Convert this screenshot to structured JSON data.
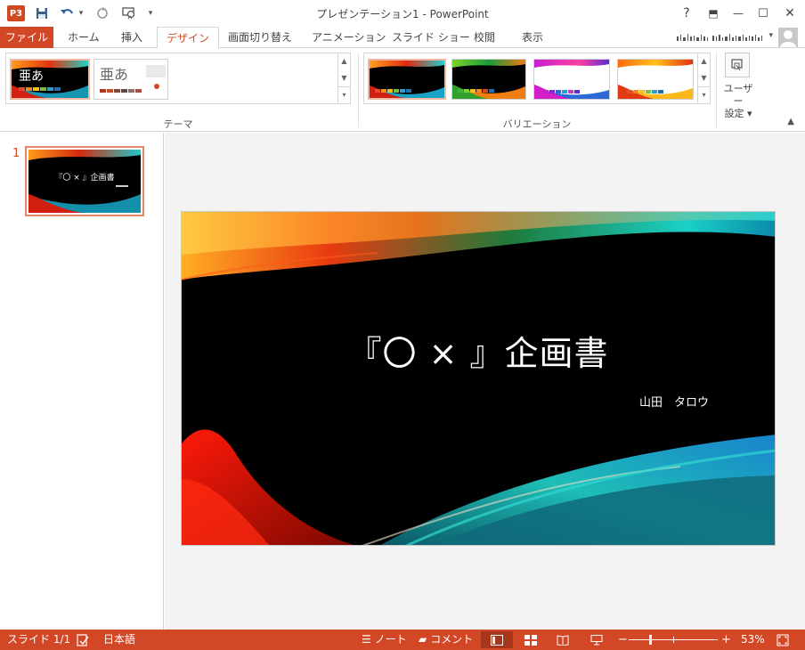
{
  "window": {
    "title": "プレゼンテーション1 - PowerPoint",
    "app_icon": "P3",
    "controls": {
      "help": "?",
      "ribbon_display": "⬒",
      "minimize": "—",
      "maximize": "☐",
      "close": "✕"
    }
  },
  "quick_access": {
    "save": "save-icon",
    "undo": "undo-icon",
    "redo": "redo-icon",
    "present": "present-from-start-icon",
    "customize": "▾"
  },
  "tabs": [
    {
      "label": "ファイル"
    },
    {
      "label": "ホーム"
    },
    {
      "label": "挿入"
    },
    {
      "label": "デザイン"
    },
    {
      "label": "画面切り替え"
    },
    {
      "label": "アニメーション"
    },
    {
      "label": "スライド ショー"
    },
    {
      "label": "校閲"
    },
    {
      "label": "表示"
    }
  ],
  "ribbon": {
    "themes_label": "テーマ",
    "theme_sample_text": "亜あ",
    "variations_label": "バリエーション",
    "customize": {
      "line1": "ユーザー",
      "line2": "設定 ▾"
    }
  },
  "slide_pane": {
    "slide_number": "1",
    "thumb_title": "『〇 × 』企画書"
  },
  "slide": {
    "title": "『〇 × 』企画書",
    "subtitle": "山田　タロウ"
  },
  "status": {
    "slide_indicator": "スライド 1/1",
    "language": "日本語",
    "notes": "ノート",
    "comments": "コメント",
    "zoom": "53%",
    "minus": "−",
    "plus": "+"
  },
  "colors": {
    "accent": "#d24726",
    "status_bg": "#d24726",
    "swatches_dark": [
      "#e14b2a",
      "#f08a1c",
      "#f3c11a",
      "#7bbd3c",
      "#2a9fcb",
      "#1b6fb6"
    ],
    "swatches_light": [
      "#a83a1f",
      "#c34f2a",
      "#7b4a3a",
      "#5b4a47",
      "#8a6f6a",
      "#a5514a"
    ]
  }
}
